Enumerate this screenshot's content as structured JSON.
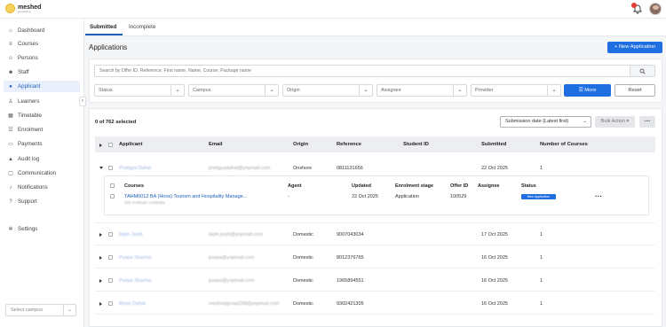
{
  "brand": {
    "name": "meshed",
    "tagline": "connecting"
  },
  "topbar": {
    "notification_count": ""
  },
  "sidebar": {
    "items": [
      {
        "label": "Dashboard",
        "icon": "home-icon"
      },
      {
        "label": "Courses",
        "icon": "courses-icon"
      },
      {
        "label": "Persons",
        "icon": "persons-icon"
      },
      {
        "label": "Staff",
        "icon": "staff-icon"
      },
      {
        "label": "Applicant",
        "icon": "applicant-icon"
      },
      {
        "label": "Learners",
        "icon": "learners-icon"
      },
      {
        "label": "Timetable",
        "icon": "timetable-icon"
      },
      {
        "label": "Enrolment",
        "icon": "enrolment-icon"
      },
      {
        "label": "Payments",
        "icon": "payments-icon"
      },
      {
        "label": "Audit log",
        "icon": "audit-icon"
      },
      {
        "label": "Communication",
        "icon": "communication-icon"
      },
      {
        "label": "Notifications",
        "icon": "bell-icon"
      },
      {
        "label": "Support",
        "icon": "support-icon"
      },
      {
        "label": "Settings",
        "icon": "gear-icon"
      }
    ],
    "campus_placeholder": "Select campus"
  },
  "tabs": [
    {
      "label": "Submitted"
    },
    {
      "label": "Incomplete"
    }
  ],
  "header": {
    "title": "Applications",
    "new_button": "+ New Application"
  },
  "filters": {
    "search_placeholder": "Search by Offer ID, Reference, First name, Name, Course, Package name",
    "status": "Status",
    "campus": "Campus",
    "origin": "Origin",
    "assignee": "Assignee",
    "provider": "Provider",
    "more_label": "More",
    "reset_label": "Reset"
  },
  "table": {
    "selected_count": "0 of 762 selected",
    "sort": "Submission date (Latest first)",
    "bulk_action": "Bulk Action",
    "columns": [
      "Applicant",
      "Email",
      "Origin",
      "Reference",
      "Student ID",
      "Submitted",
      "Number of Courses"
    ],
    "rows": [
      {
        "applicant": "Pratigya Dahal",
        "email": "pratigyadahal@yopmail.com",
        "origin": "Onshore",
        "reference": "0811131656",
        "student_id": "",
        "submitted": "22 Oct 2025",
        "courses": "1"
      },
      {
        "applicant": "Bipin Joshi",
        "email": "bipin.joshi@yopmail.com",
        "origin": "Domestic",
        "reference": "9007043034",
        "student_id": "",
        "submitted": "17 Oct 2025",
        "courses": "1"
      },
      {
        "applicant": "Puspa Sharma",
        "email": "puspa@yopmail.com",
        "origin": "Domestic",
        "reference": "8012376765",
        "student_id": "",
        "submitted": "16 Oct 2025",
        "courses": "1"
      },
      {
        "applicant": "Puspa Sharma",
        "email": "puspa@yopmail.com",
        "origin": "Domestic",
        "reference": "1965894551",
        "student_id": "",
        "submitted": "16 Oct 2025",
        "courses": "1"
      },
      {
        "applicant": "Bivan Dahal",
        "email": "meshedgroup298@yopmail.com",
        "origin": "Domestic",
        "reference": "9302421305",
        "student_id": "",
        "submitted": "16 Oct 2025",
        "courses": "1"
      }
    ]
  },
  "subtable": {
    "columns": [
      "Courses",
      "Agent",
      "Updated",
      "Enrolment stage",
      "Offer ID",
      "Assignee",
      "Status"
    ],
    "row": {
      "course": "TAHM0012 BA (Hons) Tourism and Hospitality Manage...",
      "institution": "ISK Institute Australia",
      "agent": "-",
      "updated": "22 Oct 2025",
      "stage": "Application",
      "offer_id": "100529",
      "assignee": "",
      "status": "New Application"
    }
  },
  "colors": {
    "primary": "#1f6fe0",
    "active_nav_bg": "#e9f0fb",
    "badge": "#e53935"
  }
}
